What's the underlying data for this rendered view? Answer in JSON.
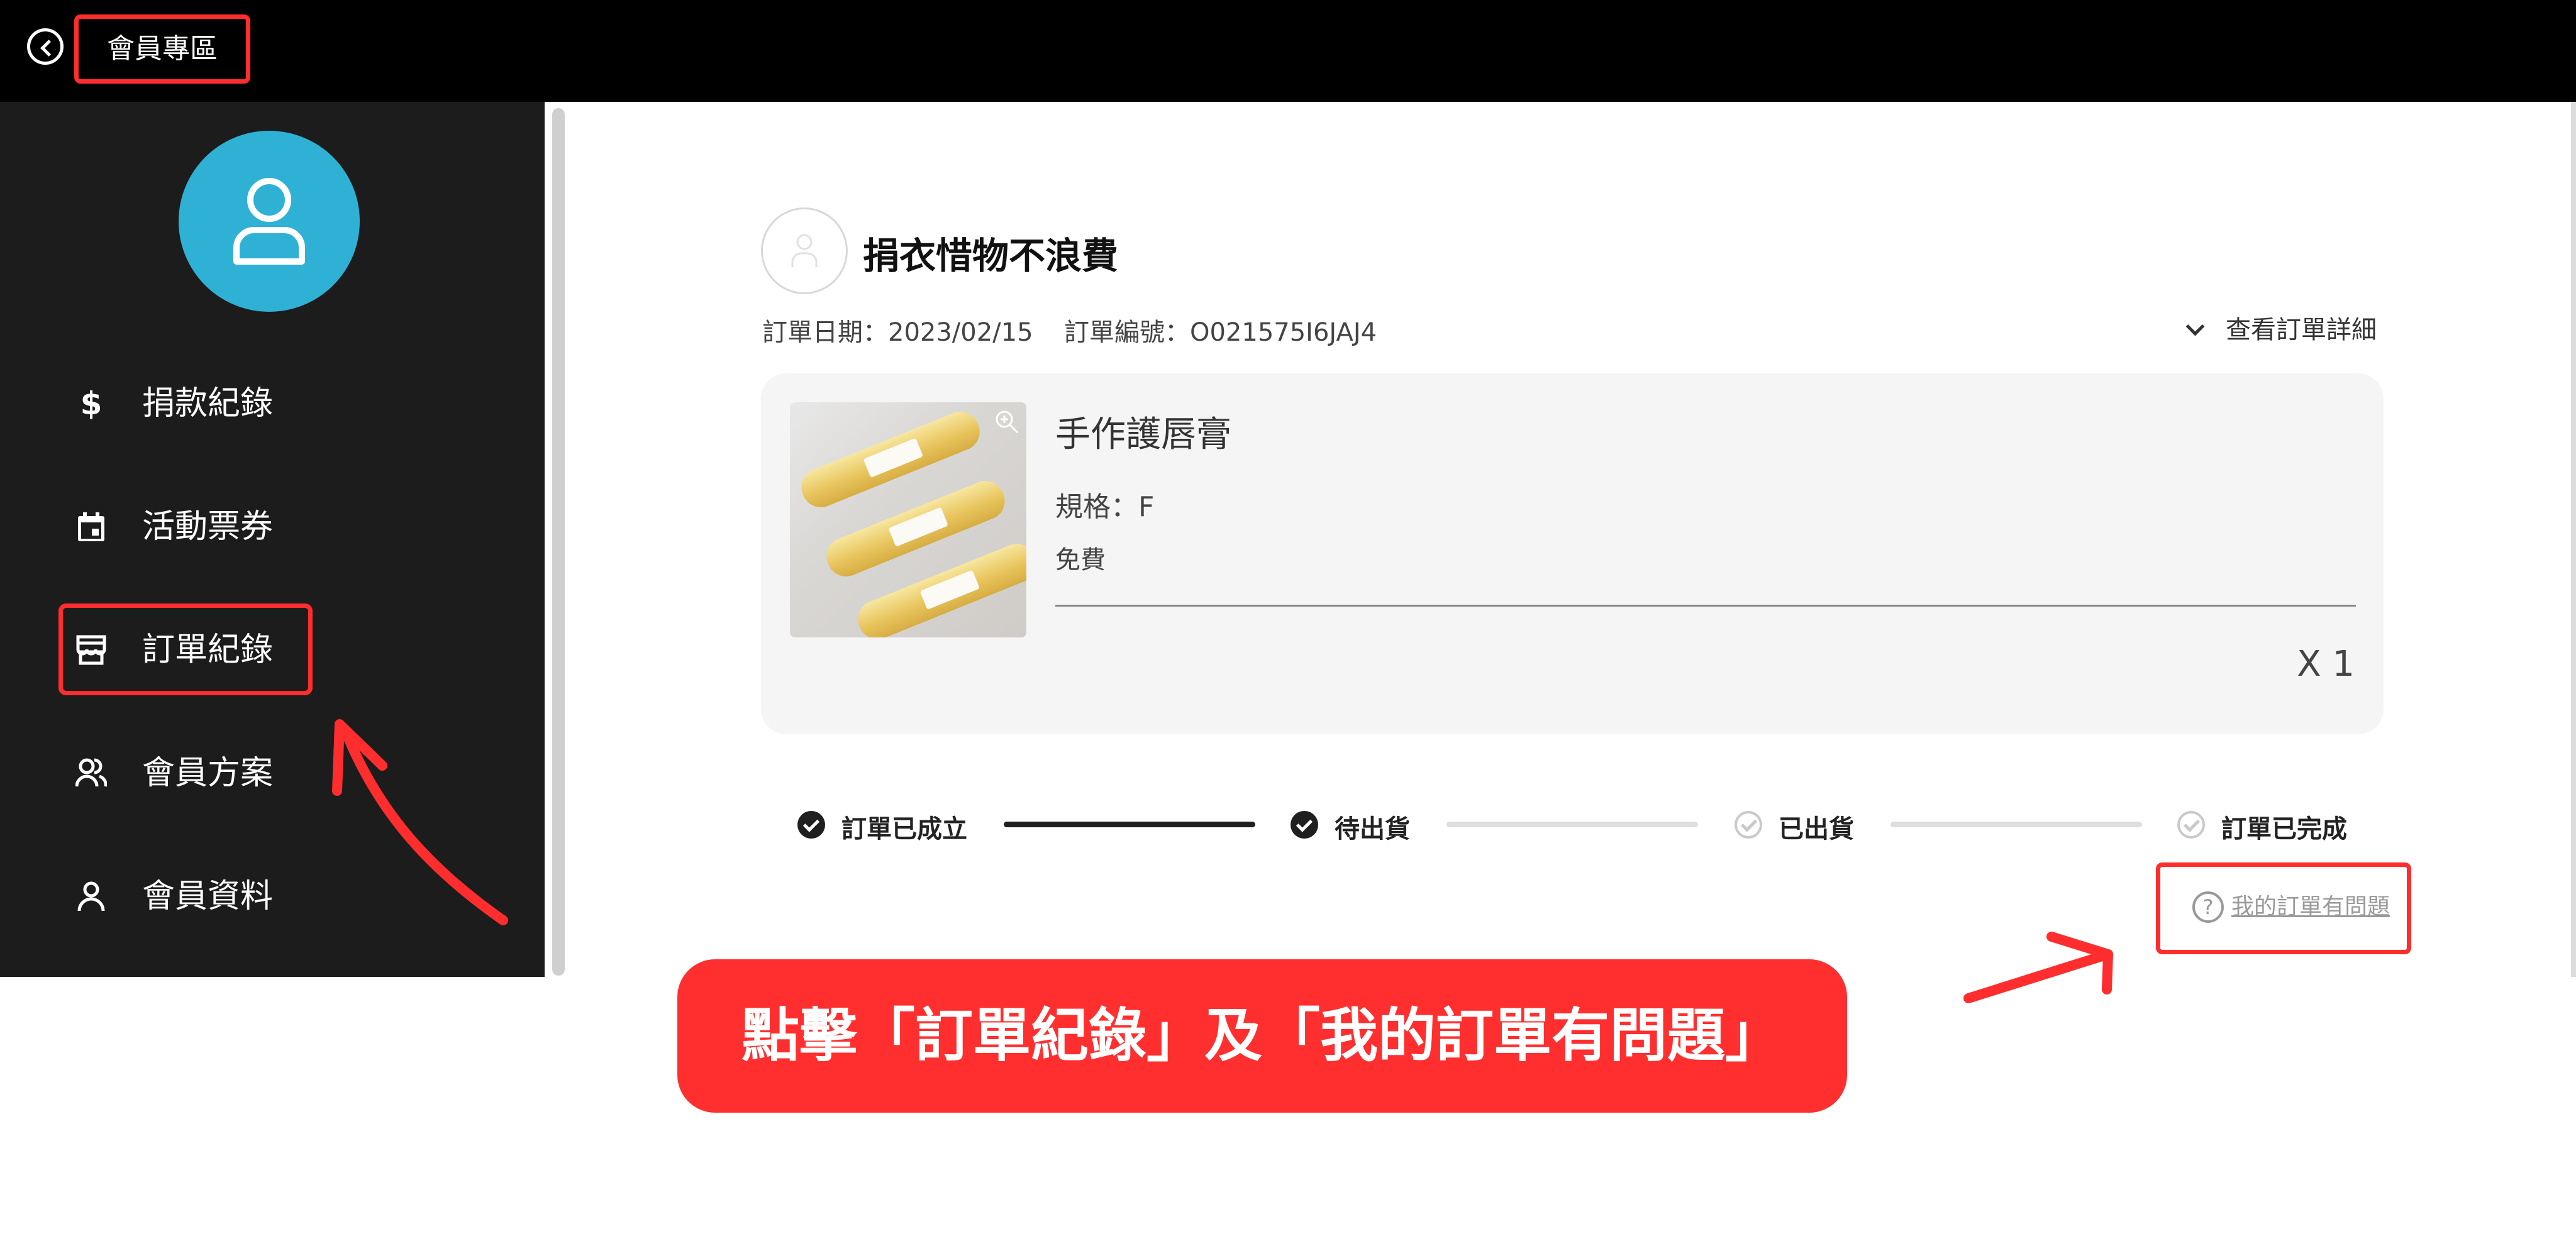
{
  "header": {
    "back_icon": "chevron-left-icon",
    "title": "會員專區"
  },
  "sidebar": {
    "avatar_icon": "user-icon",
    "items": [
      {
        "icon": "dollar-icon",
        "label": "捐款紀錄"
      },
      {
        "icon": "calendar-icon",
        "label": "活動票券"
      },
      {
        "icon": "store-icon",
        "label": "訂單紀錄"
      },
      {
        "icon": "users-icon",
        "label": "會員方案"
      },
      {
        "icon": "user-icon",
        "label": "會員資料"
      }
    ],
    "highlighted_item": "訂單紀錄"
  },
  "order": {
    "store_name": "捐衣惜物不浪費",
    "date": "訂單日期：2023/02/15",
    "number": "訂單編號：O021575I6JAJ4",
    "detail_link": "查看訂單詳細",
    "product": {
      "name": "手作護唇膏",
      "spec": "規格：F",
      "price": "免費",
      "quantity": "X 1"
    },
    "steps": [
      {
        "label": "訂單已成立",
        "done": true
      },
      {
        "label": "待出貨",
        "done": true
      },
      {
        "label": "已出貨",
        "done": false
      },
      {
        "label": "訂單已完成",
        "done": false
      }
    ],
    "problem_link": "我的訂單有問題",
    "problem_icon": "question-icon"
  },
  "annotation": {
    "banner": "點擊「訂單紀錄」及「我的訂單有問題」"
  },
  "colors": {
    "accent_red": "#ff2f2f",
    "avatar_blue": "#2fb1d6",
    "sidebar_bg": "#1c1c1c",
    "topbar_bg": "#000000",
    "card_bg": "#f5f5f5"
  }
}
